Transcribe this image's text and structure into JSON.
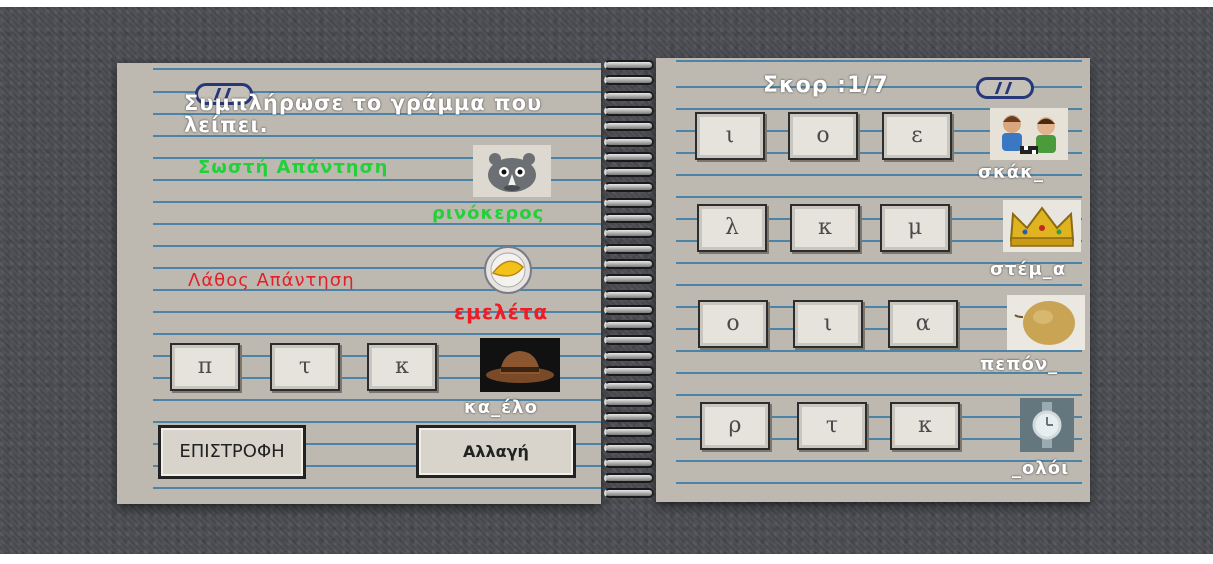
{
  "instruction": "Συμπλήρωσε το γράμμα που λείπει.",
  "feedback": {
    "correct_label": "Σωστή Απάντηση",
    "correct_word": "ρινόκερος",
    "wrong_label": "Λάθος Απάντηση",
    "wrong_word": "εμελέτα"
  },
  "score": {
    "text": "Σκορ :1/7"
  },
  "left_question": {
    "options": [
      "π",
      "τ",
      "κ"
    ],
    "word": "κα_έλο",
    "image_icon": "hat-icon"
  },
  "right_questions": [
    {
      "options": [
        "ι",
        "ο",
        "ε"
      ],
      "word": "σκάκ_",
      "image_icon": "kids-playing-chess-icon"
    },
    {
      "options": [
        "λ",
        "κ",
        "μ"
      ],
      "word": "στέμ_α",
      "image_icon": "crown-icon"
    },
    {
      "options": [
        "ο",
        "ι",
        "α"
      ],
      "word": "πεπόν_",
      "image_icon": "melon-icon"
    },
    {
      "options": [
        "ρ",
        "τ",
        "κ"
      ],
      "word": "_ολόι",
      "image_icon": "wristwatch-icon"
    }
  ],
  "buttons": {
    "back": "ΕΠΙΣΤΡΟΦΗ",
    "change": "Αλλαγή"
  },
  "feedback_images": {
    "correct": "rhino-icon",
    "wrong": "omelette-icon"
  },
  "colors": {
    "correct": "#22d13a",
    "wrong": "#ee1c24",
    "page": "#bdb9b1",
    "line": "#3f7ea7"
  }
}
